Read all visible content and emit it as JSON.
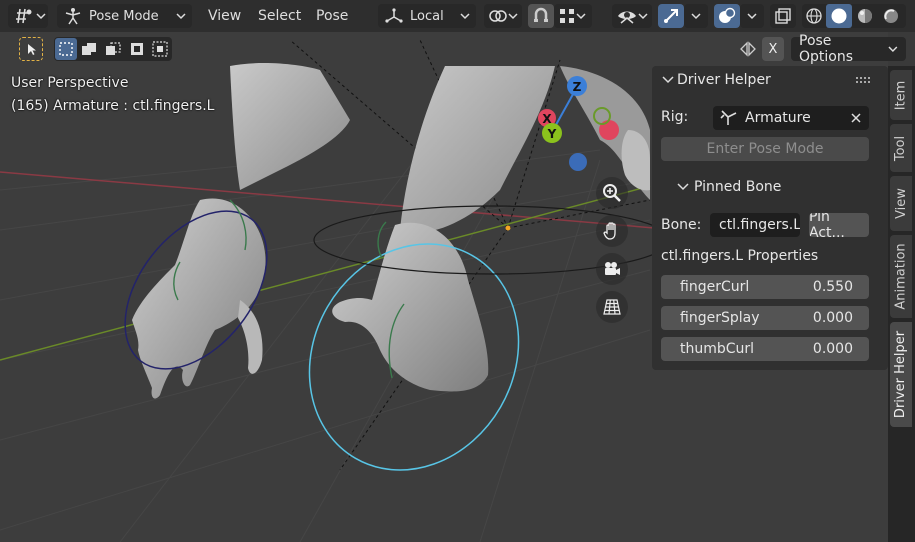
{
  "header": {
    "mode_label": "Pose Mode",
    "menus": [
      "View",
      "Select",
      "Pose"
    ],
    "orientation_label": "Local",
    "icons": [
      "editor-type-icon",
      "pose-mode-icon",
      "transform-orientation-icon",
      "pivot-icon",
      "snap-icon",
      "snap-target-icon",
      "visibility-icon",
      "gizmo-icon",
      "overlay-icon",
      "xray-icon",
      "wireframe-icon",
      "solid-icon",
      "material-icon",
      "rendered-icon"
    ]
  },
  "toolbar": {
    "x_label": "X",
    "pose_options_label": "Pose Options",
    "icons": [
      "select-tool-icon",
      "select-box-mode-icon",
      "mirror-icon"
    ]
  },
  "viewport": {
    "perspective_label": "User Perspective",
    "object_label": "(165) Armature : ctl.fingers.L",
    "gizmo_axes": [
      "X",
      "Y",
      "Z"
    ],
    "nav_icons": [
      "zoom-icon",
      "pan-hand-icon",
      "camera-icon",
      "grid-perspective-icon"
    ]
  },
  "panel": {
    "title": "Driver Helper",
    "rig_label": "Rig:",
    "rig_value": "Armature",
    "enter_pose_label": "Enter Pose Mode",
    "pinned_title": "Pinned Bone",
    "bone_label": "Bone:",
    "bone_value": "ctl.fingers.L",
    "pin_button_label": "Pin Act...",
    "properties_title": "ctl.fingers.L Properties",
    "properties": [
      {
        "name": "fingerCurl",
        "value": "0.550"
      },
      {
        "name": "fingerSplay",
        "value": "0.000"
      },
      {
        "name": "thumbCurl",
        "value": "0.000"
      }
    ]
  },
  "tabs": [
    "Item",
    "Tool",
    "View",
    "Animation",
    "Driver Helper"
  ],
  "colors": {
    "accent": "#4b6a93",
    "panel_bg": "#303030",
    "field_bg": "#545454",
    "axis_x": "#e0455e",
    "axis_y": "#8bc21d",
    "axis_z": "#3b7fd8",
    "bone_selected": "#58c5e6"
  }
}
